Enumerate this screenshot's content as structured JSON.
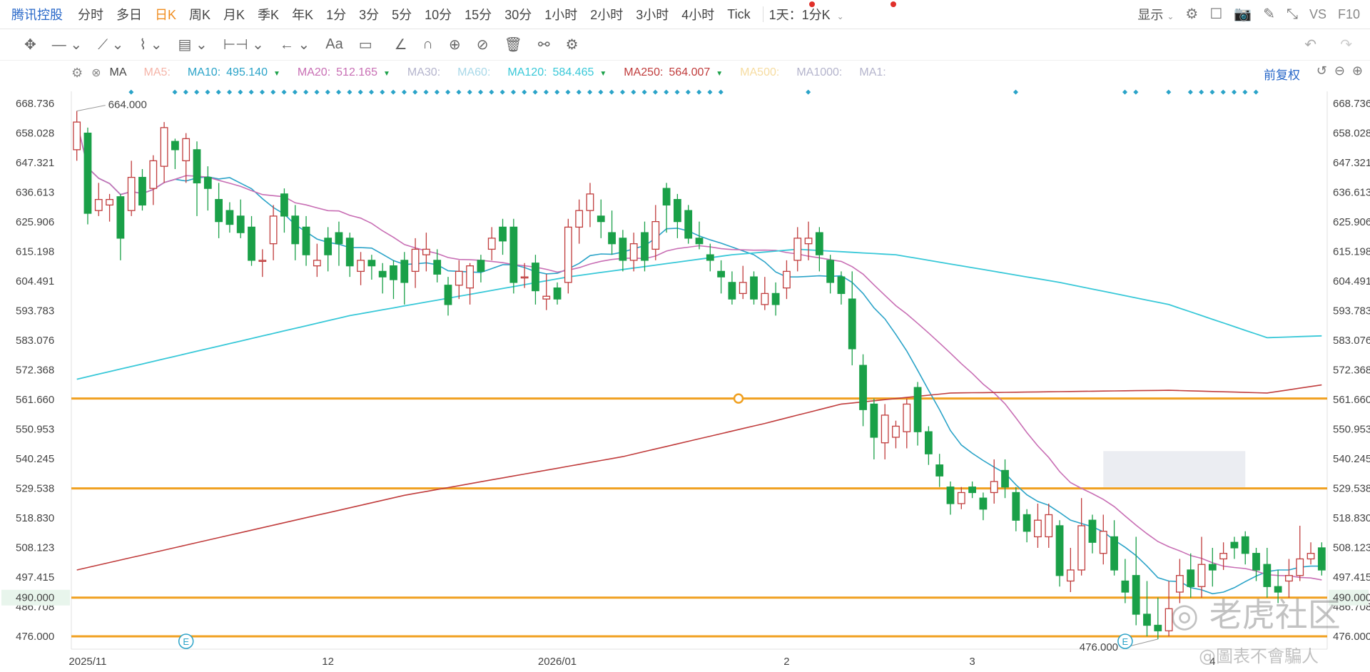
{
  "toolbar": {
    "stock_name": "腾讯控股",
    "periods": [
      "分时",
      "多日",
      "日K",
      "周K",
      "月K",
      "季K",
      "年K",
      "1分",
      "3分",
      "5分",
      "10分",
      "15分",
      "30分",
      "1小时",
      "2小时",
      "3小时",
      "4小时",
      "Tick"
    ],
    "active_period": "日K",
    "range_label": "1天：1分K",
    "display_label": "显示",
    "compare_label": "VS",
    "f10_label": "F10"
  },
  "ma_bar": {
    "indicator": "MA",
    "items": [
      {
        "name": "MA5:",
        "value": "",
        "color": "#f5b4a8",
        "arrow": ""
      },
      {
        "name": "MA10:",
        "value": "495.140",
        "color": "#2aa3c8",
        "arrow": "▼"
      },
      {
        "name": "MA20:",
        "value": "512.165",
        "color": "#c86eb4",
        "arrow": "▼"
      },
      {
        "name": "MA30:",
        "value": "",
        "color": "#b4b4cc",
        "arrow": ""
      },
      {
        "name": "MA60:",
        "value": "",
        "color": "#a8d8e8",
        "arrow": ""
      },
      {
        "name": "MA120:",
        "value": "584.465",
        "color": "#38c8d8",
        "arrow": "▼"
      },
      {
        "name": "MA250:",
        "value": "564.007",
        "color": "#c03c3c",
        "arrow": "▼"
      },
      {
        "name": "MA500:",
        "value": "",
        "color": "#f6dca0",
        "arrow": ""
      },
      {
        "name": "MA1000:",
        "value": "",
        "color": "#b4b4cc",
        "arrow": ""
      },
      {
        "name": "MA1:",
        "value": "",
        "color": "#b4b4cc",
        "arrow": ""
      }
    ],
    "adjust_label": "前复权"
  },
  "colors": {
    "up": "#c03c3c",
    "down": "#1aa048",
    "ma10": "#2aa3c8",
    "ma20": "#c86eb4",
    "ma120": "#38c8d8",
    "ma250": "#c03c3c",
    "hline": "#f0a020",
    "axis_highlight": "#1aa048"
  },
  "chart_data": {
    "type": "candlestick",
    "y_ticks": [
      "668.736",
      "658.028",
      "647.321",
      "636.613",
      "625.906",
      "615.198",
      "604.491",
      "593.783",
      "583.076",
      "572.368",
      "561.660",
      "550.953",
      "540.245",
      "529.538",
      "518.830",
      "508.123",
      "497.415",
      "486.708",
      "476.000"
    ],
    "y_range": [
      476.0,
      668.736
    ],
    "x_labels": [
      {
        "label": "2025/11",
        "index": 1
      },
      {
        "label": "12",
        "index": 23
      },
      {
        "label": "2026/01",
        "index": 44
      },
      {
        "label": "2",
        "index": 65
      },
      {
        "label": "3",
        "index": 82
      },
      {
        "label": "4",
        "index": 104
      }
    ],
    "high_label": "664.000",
    "low_label": "476.000",
    "highlight_price": "490.000",
    "horizontal_lines": [
      562.0,
      529.5,
      490.0,
      476.0
    ],
    "shaded_zone": {
      "from_index": 94,
      "to_index": 107,
      "price_top": 543.0,
      "price_bottom": 530.0
    },
    "event_markers": [
      {
        "symbol": "E",
        "index": 10
      },
      {
        "symbol": "E",
        "index": 96
      }
    ],
    "candles": [
      [
        652,
        662,
        666,
        648
      ],
      [
        658,
        629,
        660,
        625
      ],
      [
        630,
        634,
        640,
        628
      ],
      [
        632,
        634,
        636,
        626
      ],
      [
        635,
        620,
        636,
        612
      ],
      [
        630,
        642,
        648,
        628
      ],
      [
        642,
        632,
        645,
        630
      ],
      [
        638,
        648,
        650,
        632
      ],
      [
        646,
        660,
        662,
        640
      ],
      [
        655,
        652,
        656,
        645
      ],
      [
        648,
        656,
        658,
        640
      ],
      [
        652,
        640,
        655,
        628
      ],
      [
        642,
        638,
        646,
        630
      ],
      [
        634,
        626,
        640,
        620
      ],
      [
        630,
        625,
        633,
        622
      ],
      [
        628,
        622,
        634,
        620
      ],
      [
        624,
        612,
        628,
        610
      ],
      [
        612,
        612,
        616,
        606
      ],
      [
        618,
        628,
        632,
        612
      ],
      [
        636,
        628,
        638,
        622
      ],
      [
        628,
        618,
        632,
        612
      ],
      [
        624,
        614,
        628,
        610
      ],
      [
        610,
        612,
        618,
        606
      ],
      [
        620,
        614,
        624,
        608
      ],
      [
        622,
        618,
        626,
        610
      ],
      [
        620,
        610,
        622,
        606
      ],
      [
        608,
        612,
        615,
        603
      ],
      [
        612,
        610,
        614,
        605
      ],
      [
        608,
        606,
        611,
        600
      ],
      [
        610,
        605,
        612,
        598
      ],
      [
        612,
        604,
        615,
        596
      ],
      [
        608,
        616,
        620,
        602
      ],
      [
        614,
        616,
        622,
        608
      ],
      [
        612,
        607,
        616,
        604
      ],
      [
        603,
        596,
        606,
        592
      ],
      [
        603,
        608,
        612,
        598
      ],
      [
        602,
        610,
        611,
        596
      ],
      [
        612,
        608,
        614,
        604
      ],
      [
        616,
        620,
        624,
        612
      ],
      [
        624,
        619,
        627,
        614
      ],
      [
        624,
        604,
        627,
        600
      ],
      [
        606,
        606,
        611,
        602
      ],
      [
        611,
        601,
        614,
        596
      ],
      [
        598,
        599,
        607,
        594
      ],
      [
        602,
        598,
        604,
        596
      ],
      [
        604,
        624,
        627,
        600
      ],
      [
        624,
        630,
        634,
        618
      ],
      [
        630,
        636,
        640,
        624
      ],
      [
        628,
        626,
        634,
        620
      ],
      [
        622,
        618,
        630,
        614
      ],
      [
        620,
        612,
        623,
        608
      ],
      [
        612,
        618,
        622,
        608
      ],
      [
        622,
        612,
        626,
        608
      ],
      [
        616,
        626,
        632,
        612
      ],
      [
        638,
        632,
        640,
        622
      ],
      [
        634,
        626,
        636,
        620
      ],
      [
        630,
        620,
        632,
        618
      ],
      [
        620,
        618,
        626,
        616
      ],
      [
        614,
        612,
        618,
        608
      ],
      [
        608,
        606,
        612,
        600
      ],
      [
        604,
        598,
        608,
        596
      ],
      [
        600,
        604,
        610,
        598
      ],
      [
        606,
        598,
        608,
        596
      ],
      [
        596,
        600,
        606,
        594
      ],
      [
        600,
        596,
        604,
        592
      ],
      [
        602,
        608,
        612,
        598
      ],
      [
        612,
        620,
        624,
        608
      ],
      [
        618,
        620,
        626,
        612
      ],
      [
        622,
        614,
        624,
        608
      ],
      [
        612,
        604,
        614,
        600
      ],
      [
        606,
        600,
        608,
        596
      ],
      [
        598,
        580,
        608,
        574
      ],
      [
        574,
        558,
        578,
        552
      ],
      [
        560,
        548,
        562,
        540
      ],
      [
        546,
        556,
        560,
        540
      ],
      [
        548,
        552,
        554,
        544
      ],
      [
        550,
        560,
        562,
        544
      ],
      [
        566,
        550,
        568,
        545
      ],
      [
        550,
        542,
        552,
        538
      ],
      [
        538,
        534,
        542,
        530
      ],
      [
        530,
        524,
        532,
        520
      ],
      [
        524,
        528,
        530,
        522
      ],
      [
        530,
        528,
        532,
        526
      ],
      [
        526,
        522,
        528,
        518
      ],
      [
        528,
        532,
        540,
        524
      ],
      [
        536,
        530,
        540,
        526
      ],
      [
        528,
        518,
        530,
        514
      ],
      [
        520,
        514,
        522,
        510
      ],
      [
        512,
        518,
        524,
        508
      ],
      [
        512,
        520,
        524,
        508
      ],
      [
        516,
        498,
        518,
        494
      ],
      [
        496,
        500,
        508,
        492
      ],
      [
        500,
        516,
        526,
        498
      ],
      [
        518,
        510,
        520,
        506
      ],
      [
        506,
        514,
        520,
        502
      ],
      [
        512,
        500,
        518,
        498
      ],
      [
        496,
        492,
        504,
        488
      ],
      [
        498,
        484,
        512,
        480
      ],
      [
        484,
        480,
        496,
        476
      ],
      [
        480,
        478,
        490,
        475
      ],
      [
        478,
        486,
        496,
        476
      ],
      [
        492,
        498,
        504,
        488
      ],
      [
        500,
        494,
        506,
        490
      ],
      [
        494,
        502,
        512,
        490
      ],
      [
        502,
        500,
        508,
        494
      ],
      [
        504,
        506,
        510,
        500
      ],
      [
        510,
        508,
        512,
        504
      ],
      [
        512,
        506,
        514,
        502
      ],
      [
        506,
        500,
        508,
        496
      ],
      [
        502,
        494,
        508,
        490
      ],
      [
        494,
        492,
        500,
        488
      ],
      [
        496,
        498,
        504,
        490
      ],
      [
        498,
        504,
        516,
        496
      ],
      [
        504,
        506,
        510,
        502
      ],
      [
        508,
        500,
        510,
        498
      ]
    ]
  }
}
